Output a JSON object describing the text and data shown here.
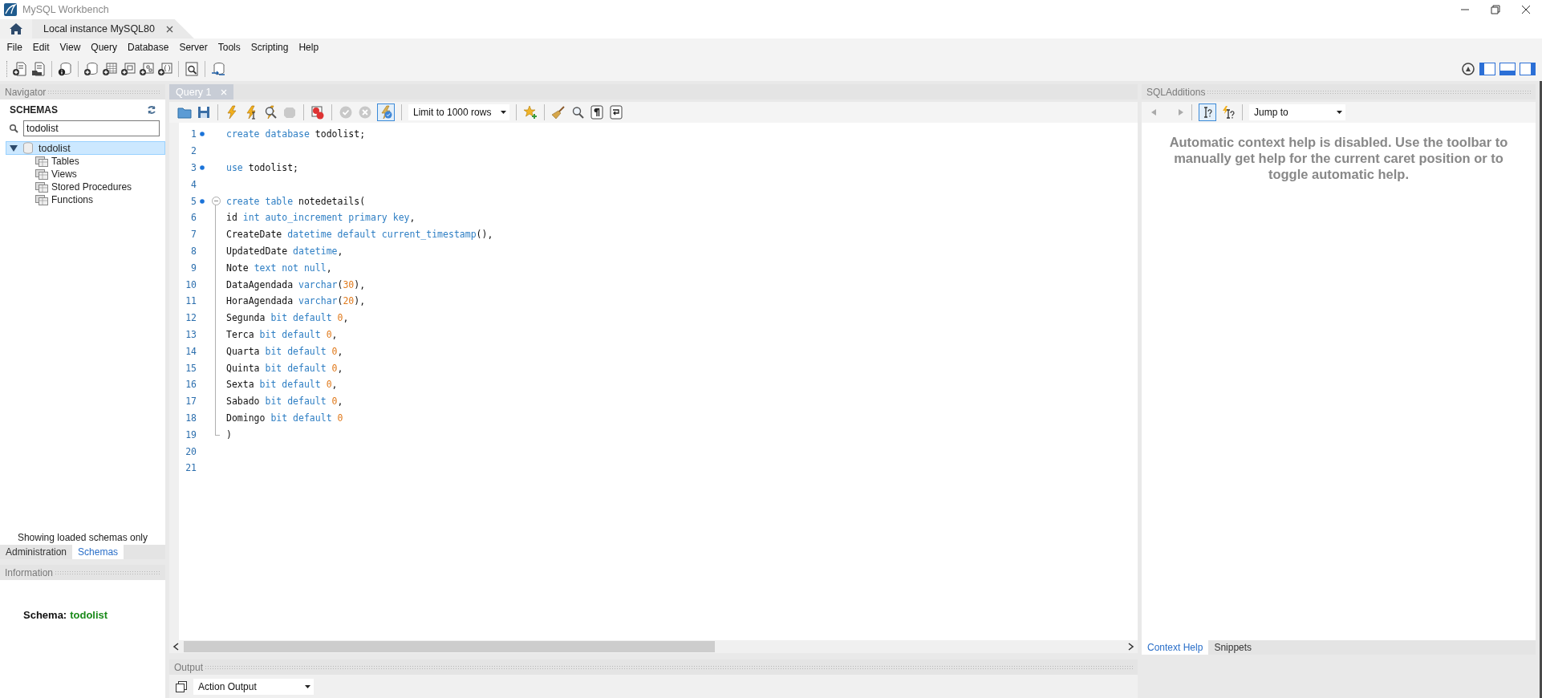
{
  "window": {
    "title": "MySQL Workbench"
  },
  "connection_tab": {
    "label": "Local instance MySQL80",
    "selected": true
  },
  "menu": [
    "File",
    "Edit",
    "View",
    "Query",
    "Database",
    "Server",
    "Tools",
    "Scripting",
    "Help"
  ],
  "navigator": {
    "title": "Navigator",
    "section": "SCHEMAS",
    "search": {
      "value": "todolist"
    },
    "tree": [
      {
        "label": "todolist",
        "expanded": true,
        "selected": true,
        "children": [
          {
            "label": "Tables"
          },
          {
            "label": "Views"
          },
          {
            "label": "Stored Procedures"
          },
          {
            "label": "Functions"
          }
        ]
      }
    ],
    "note": "Showing loaded schemas only",
    "tabs": [
      {
        "label": "Administration",
        "selected": false
      },
      {
        "label": "Schemas",
        "selected": true
      }
    ]
  },
  "information": {
    "title": "Information",
    "label": "Schema:",
    "value": "todolist"
  },
  "editor": {
    "tab": {
      "label": "Query 1",
      "selected": true
    },
    "autocommit_selected": true,
    "limit": "Limit to 1000 rows",
    "lines": [
      {
        "n": "1",
        "marker": true,
        "kind": "plain",
        "tokens": [
          {
            "kind": "kw",
            "text": "create database "
          },
          {
            "kind": "id",
            "text": "todolist;"
          }
        ]
      },
      {
        "n": "2",
        "marker": false,
        "kind": "plain"
      },
      {
        "n": "3",
        "marker": true,
        "kind": "plain",
        "tokens": [
          {
            "kind": "kw",
            "text": "use "
          },
          {
            "kind": "id",
            "text": "todolist;"
          }
        ]
      },
      {
        "n": "4",
        "marker": false,
        "kind": "plain"
      },
      {
        "n": "5",
        "marker": true,
        "kind": "fold_start",
        "tokens": [
          {
            "kind": "kw",
            "text": "create table "
          },
          {
            "kind": "id",
            "text": "notedetails("
          }
        ]
      },
      {
        "n": "6",
        "marker": false,
        "kind": "fold_body",
        "tokens": [
          {
            "kind": "id",
            "text": "id "
          },
          {
            "kind": "kw",
            "text": "int auto_increment primary key"
          },
          {
            "kind": "id",
            "text": ","
          }
        ]
      },
      {
        "n": "7",
        "marker": false,
        "kind": "fold_body",
        "tokens": [
          {
            "kind": "id",
            "text": "CreateDate "
          },
          {
            "kind": "kw",
            "text": "datetime default current_timestamp"
          },
          {
            "kind": "id",
            "text": "(),"
          }
        ]
      },
      {
        "n": "8",
        "marker": false,
        "kind": "fold_body",
        "tokens": [
          {
            "kind": "id",
            "text": "UpdatedDate "
          },
          {
            "kind": "kw",
            "text": "datetime"
          },
          {
            "kind": "id",
            "text": ","
          }
        ]
      },
      {
        "n": "9",
        "marker": false,
        "kind": "fold_body",
        "tokens": [
          {
            "kind": "id",
            "text": "Note "
          },
          {
            "kind": "kw",
            "text": "text not null"
          },
          {
            "kind": "id",
            "text": ","
          }
        ]
      },
      {
        "n": "10",
        "marker": false,
        "kind": "fold_body",
        "tokens": [
          {
            "kind": "id",
            "text": "DataAgendada "
          },
          {
            "kind": "kw",
            "text": "varchar"
          },
          {
            "kind": "id",
            "text": "("
          },
          {
            "kind": "num",
            "text": "30"
          },
          {
            "kind": "id",
            "text": "),"
          }
        ]
      },
      {
        "n": "11",
        "marker": false,
        "kind": "fold_body",
        "tokens": [
          {
            "kind": "id",
            "text": "HoraAgendada "
          },
          {
            "kind": "kw",
            "text": "varchar"
          },
          {
            "kind": "id",
            "text": "("
          },
          {
            "kind": "num",
            "text": "20"
          },
          {
            "kind": "id",
            "text": "),"
          }
        ]
      },
      {
        "n": "12",
        "marker": false,
        "kind": "fold_body",
        "tokens": [
          {
            "kind": "id",
            "text": "Segunda "
          },
          {
            "kind": "kw",
            "text": "bit default "
          },
          {
            "kind": "num",
            "text": "0"
          },
          {
            "kind": "id",
            "text": ","
          }
        ]
      },
      {
        "n": "13",
        "marker": false,
        "kind": "fold_body",
        "tokens": [
          {
            "kind": "id",
            "text": "Terca "
          },
          {
            "kind": "kw",
            "text": "bit default "
          },
          {
            "kind": "num",
            "text": "0"
          },
          {
            "kind": "id",
            "text": ","
          }
        ]
      },
      {
        "n": "14",
        "marker": false,
        "kind": "fold_body",
        "tokens": [
          {
            "kind": "id",
            "text": "Quarta "
          },
          {
            "kind": "kw",
            "text": "bit default "
          },
          {
            "kind": "num",
            "text": "0"
          },
          {
            "kind": "id",
            "text": ","
          }
        ]
      },
      {
        "n": "15",
        "marker": false,
        "kind": "fold_body",
        "tokens": [
          {
            "kind": "id",
            "text": "Quinta "
          },
          {
            "kind": "kw",
            "text": "bit default "
          },
          {
            "kind": "num",
            "text": "0"
          },
          {
            "kind": "id",
            "text": ","
          }
        ]
      },
      {
        "n": "16",
        "marker": false,
        "kind": "fold_body",
        "tokens": [
          {
            "kind": "id",
            "text": "Sexta "
          },
          {
            "kind": "kw",
            "text": "bit default "
          },
          {
            "kind": "num",
            "text": "0"
          },
          {
            "kind": "id",
            "text": ","
          }
        ]
      },
      {
        "n": "17",
        "marker": false,
        "kind": "fold_body",
        "tokens": [
          {
            "kind": "id",
            "text": "Sabado "
          },
          {
            "kind": "kw",
            "text": "bit default "
          },
          {
            "kind": "num",
            "text": "0"
          },
          {
            "kind": "id",
            "text": ","
          }
        ]
      },
      {
        "n": "18",
        "marker": false,
        "kind": "fold_body",
        "tokens": [
          {
            "kind": "id",
            "text": "Domingo "
          },
          {
            "kind": "kw",
            "text": "bit default "
          },
          {
            "kind": "num",
            "text": "0"
          }
        ]
      },
      {
        "n": "19",
        "marker": false,
        "kind": "fold_end",
        "tokens": [
          {
            "kind": "id",
            "text": ")"
          }
        ]
      },
      {
        "n": "20",
        "marker": false,
        "kind": "plain"
      },
      {
        "n": "21",
        "marker": false,
        "kind": "plain"
      }
    ]
  },
  "output": {
    "title": "Output",
    "selector": "Action Output"
  },
  "sql_additions": {
    "title": "SQLAdditions",
    "manual_help_selected": true,
    "jump": "Jump to",
    "help": "Automatic context help is disabled. Use the toolbar to manually get help for the current caret position or to toggle automatic help.",
    "tabs": [
      {
        "label": "Context Help",
        "selected": true
      },
      {
        "label": "Snippets",
        "selected": false
      }
    ]
  }
}
